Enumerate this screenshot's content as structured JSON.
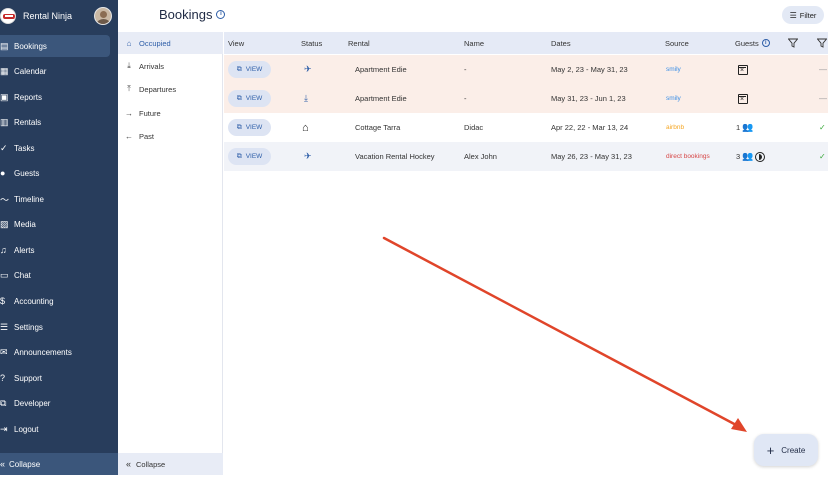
{
  "app": {
    "brand_name": "Rental Ninja"
  },
  "sidebar": {
    "items": [
      {
        "label": "Bookings",
        "icon": "bookings-icon",
        "glyph": "▤"
      },
      {
        "label": "Calendar",
        "icon": "calendar-icon",
        "glyph": "▦"
      },
      {
        "label": "Reports",
        "icon": "reports-icon",
        "glyph": "▣"
      },
      {
        "label": "Rentals",
        "icon": "rentals-icon",
        "glyph": "▥"
      },
      {
        "label": "Tasks",
        "icon": "tasks-icon",
        "glyph": "✓"
      },
      {
        "label": "Guests",
        "icon": "guests-icon",
        "glyph": "●"
      },
      {
        "label": "Timeline",
        "icon": "timeline-icon",
        "glyph": "〜"
      },
      {
        "label": "Media",
        "icon": "media-icon",
        "glyph": "▨"
      },
      {
        "label": "Alerts",
        "icon": "alerts-icon",
        "glyph": "♫"
      },
      {
        "label": "Chat",
        "icon": "chat-icon",
        "glyph": "▭"
      },
      {
        "label": "Accounting",
        "icon": "accounting-icon",
        "glyph": "$"
      },
      {
        "label": "Settings",
        "icon": "settings-icon",
        "glyph": "☰"
      },
      {
        "label": "Announcements",
        "icon": "announcements-icon",
        "glyph": "✉"
      },
      {
        "label": "Support",
        "icon": "support-icon",
        "glyph": "?"
      },
      {
        "label": "Developer",
        "icon": "developer-icon",
        "glyph": "⧉"
      },
      {
        "label": "Logout",
        "icon": "logout-icon",
        "glyph": "⇥"
      }
    ],
    "collapse_label": "Collapse"
  },
  "subnav": {
    "items": [
      {
        "label": "Occupied",
        "glyph": "⌂"
      },
      {
        "label": "Arrivals",
        "glyph": "⤓"
      },
      {
        "label": "Departures",
        "glyph": "⤒"
      },
      {
        "label": "Future",
        "glyph": "→"
      },
      {
        "label": "Past",
        "glyph": "←"
      }
    ],
    "collapse_label": "Collapse"
  },
  "header": {
    "title": "Bookings",
    "filter_label": "Filter"
  },
  "table": {
    "columns": {
      "view": "View",
      "status": "Status",
      "rental": "Rental",
      "name": "Name",
      "dates": "Dates",
      "source": "Source",
      "guests": "Guests"
    },
    "view_label": "VIEW",
    "rows": [
      {
        "status": "arrival",
        "rental": "Apartment Edie",
        "name": "-",
        "dates": "May 2, 23 - May 31, 23",
        "source": "smily",
        "guests_count": "",
        "trail": "—"
      },
      {
        "status": "arrival",
        "rental": "Apartment Edie",
        "name": "-",
        "dates": "May 31, 23 - Jun 1, 23",
        "source": "smily",
        "guests_count": "",
        "trail": "—"
      },
      {
        "status": "home",
        "rental": "Cottage Tarra",
        "name": "Didac",
        "dates": "Apr 22, 22 - Mar 13, 24",
        "source": "airbnb",
        "guests_count": "1",
        "trail": "✓"
      },
      {
        "status": "arrival",
        "rental": "Vacation Rental Hockey",
        "name": "Alex John",
        "dates": "May 26, 23 - May 31, 23",
        "source": "direct bookings",
        "guests_count": "3",
        "trail": "✓"
      }
    ]
  },
  "create": {
    "label": "Create"
  },
  "colors": {
    "sidebar_bg": "#283d5c",
    "sidebar_active": "#3b567b",
    "row_highlight": "#fbeee8",
    "row_alt": "#f1f3f8",
    "accent": "#2e5ea8",
    "source_smily": "#3a8ee6",
    "source_airbnb": "#f5a623",
    "source_direct": "#d64545",
    "arrow": "#e0452a",
    "check": "#3aa93a"
  }
}
